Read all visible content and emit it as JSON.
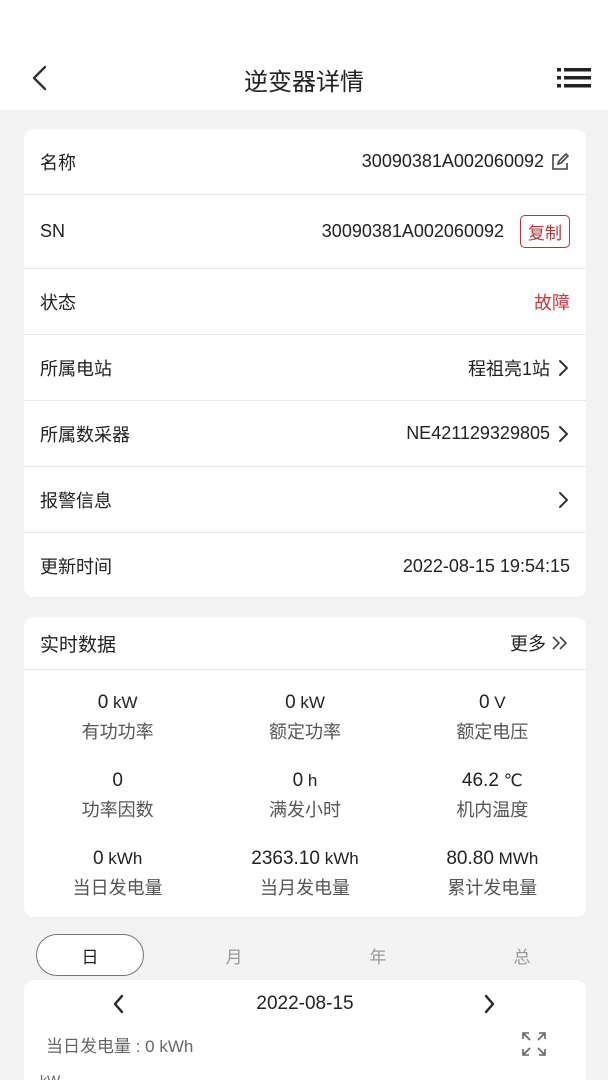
{
  "header": {
    "title": "逆变器详情"
  },
  "info": {
    "name_label": "名称",
    "name_value": "30090381A002060092",
    "sn_label": "SN",
    "sn_value": "30090381A002060092",
    "copy_label": "复制",
    "status_label": "状态",
    "status_value": "故障",
    "station_label": "所属电站",
    "station_value": "程祖亮1站",
    "collector_label": "所属数采器",
    "collector_value": "NE421129329805",
    "alarm_label": "报警信息",
    "update_label": "更新时间",
    "update_value": "2022-08-15 19:54:15"
  },
  "realtime": {
    "title": "实时数据",
    "more_label": "更多",
    "items": [
      {
        "value": "0",
        "unit": " kW",
        "label": "有功功率"
      },
      {
        "value": "0",
        "unit": " kW",
        "label": "额定功率"
      },
      {
        "value": "0",
        "unit": " V",
        "label": "额定电压"
      },
      {
        "value": "0",
        "unit": "",
        "label": "功率因数"
      },
      {
        "value": "0",
        "unit": " h",
        "label": "满发小时"
      },
      {
        "value": "46.2",
        "unit": " ℃",
        "label": "机内温度"
      },
      {
        "value": "0",
        "unit": " kWh",
        "label": "当日发电量"
      },
      {
        "value": "2363.10",
        "unit": " kWh",
        "label": "当月发电量"
      },
      {
        "value": "80.80",
        "unit": " MWh",
        "label": "累计发电量"
      }
    ]
  },
  "tabs": {
    "day": "日",
    "month": "月",
    "year": "年",
    "total": "总"
  },
  "chart_section": {
    "date": "2022-08-15",
    "day_total": "当日发电量 : 0 kWh",
    "axis_unit_partial": "kW"
  },
  "colors": {
    "fault": "#c83c3c",
    "copy_border": "#a83a3a",
    "background": "#f3f3f3"
  }
}
